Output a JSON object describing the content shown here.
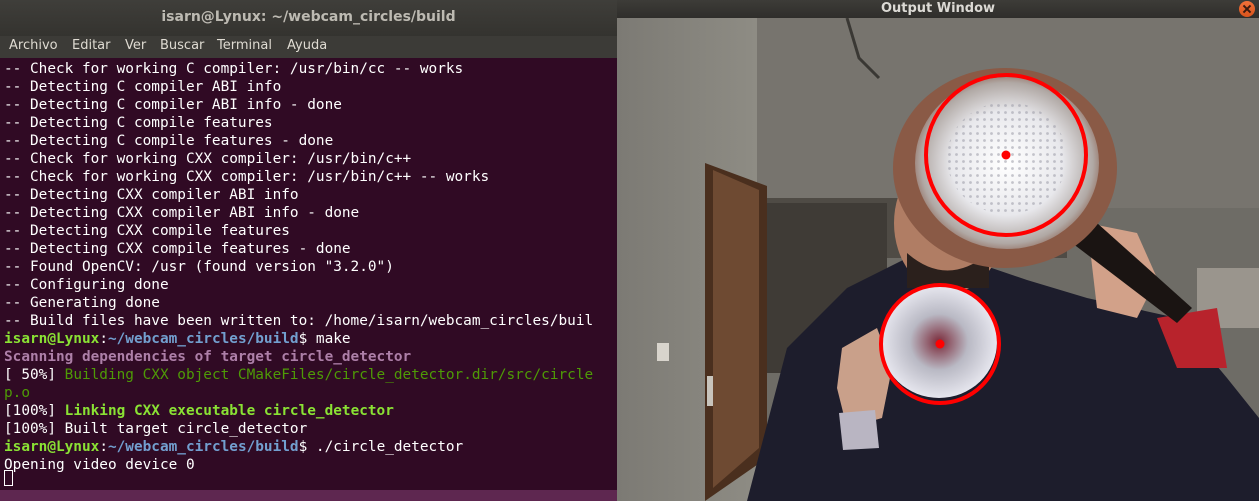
{
  "terminal": {
    "title": "isarn@Lynux: ~/webcam_circles/build",
    "menu": [
      "Archivo",
      "Editar",
      "Ver",
      "Buscar",
      "Terminal",
      "Ayuda"
    ],
    "lines": [
      "-- Check for working C compiler: /usr/bin/cc -- works",
      "-- Detecting C compiler ABI info",
      "-- Detecting C compiler ABI info - done",
      "-- Detecting C compile features",
      "-- Detecting C compile features - done",
      "-- Check for working CXX compiler: /usr/bin/c++",
      "-- Check for working CXX compiler: /usr/bin/c++ -- works",
      "-- Detecting CXX compiler ABI info",
      "-- Detecting CXX compiler ABI info - done",
      "-- Detecting CXX compile features",
      "-- Detecting CXX compile features - done",
      "-- Found OpenCV: /usr (found version \"3.2.0\")",
      "-- Configuring done",
      "-- Generating done",
      "-- Build files have been written to: /home/isarn/webcam_circles/buil"
    ],
    "prompt": {
      "user": "isarn@Lynux",
      "sep": ":",
      "path": "~/webcam_circles/build",
      "sign": "$ "
    },
    "cmd1": "make",
    "scanning": "Scanning dependencies of target circle_detector",
    "build_pct": "[ 50%] ",
    "build_msg": "Building CXX object CMakeFiles/circle_detector.dir/src/circle",
    "build_msg_cont": "p.o",
    "link_pct": "[100%] ",
    "link_msg": "Linking CXX executable circle_detector",
    "built": "[100%] Built target circle_detector",
    "cmd2": "./circle_detector",
    "opening": "Opening video device 0"
  },
  "output_window": {
    "title": "Output Window",
    "detected_circle_color": "#ff0000"
  },
  "colors": {
    "terminal_bg": "#300a24",
    "prompt_user": "#8ae234",
    "prompt_path": "#729fcf"
  }
}
